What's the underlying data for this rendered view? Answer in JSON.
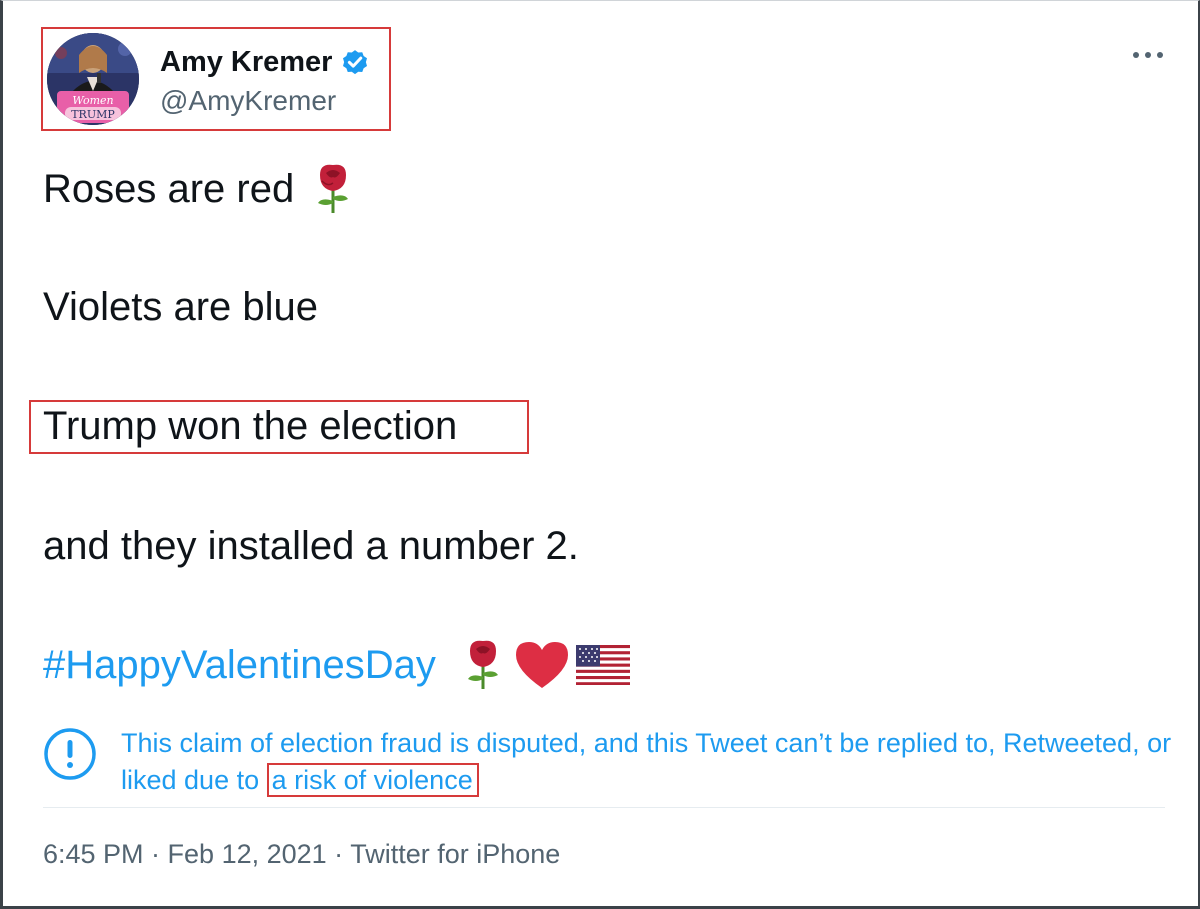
{
  "tweet": {
    "author": {
      "display_name": "Amy Kremer",
      "handle": "@AmyKremer",
      "verified": true,
      "avatar_text_top": "Women",
      "avatar_text_bottom": "TRUMP"
    },
    "more_icon": "more-horizontal-icon",
    "lines": [
      "Roses are red",
      "Violets are blue",
      "Trump won the election",
      "and they installed a number 2."
    ],
    "hashtag": "#HappyValentinesDay",
    "emoji": [
      "rose",
      "red-heart",
      "us-flag"
    ],
    "notice": {
      "icon": "exclamation-circle-icon",
      "text": "This claim of election fraud is disputed, and this Tweet can’t be replied to, Retweeted, or liked due to",
      "link_text": "a risk of violence"
    },
    "timestamp": "6:45 PM · Feb 12, 2021 · ",
    "source": "Twitter for iPhone"
  },
  "colors": {
    "link_blue": "#1d9bf0",
    "highlight_red": "#d63a3a",
    "secondary_text": "#536471",
    "verified_blue": "#1d9bf0"
  }
}
